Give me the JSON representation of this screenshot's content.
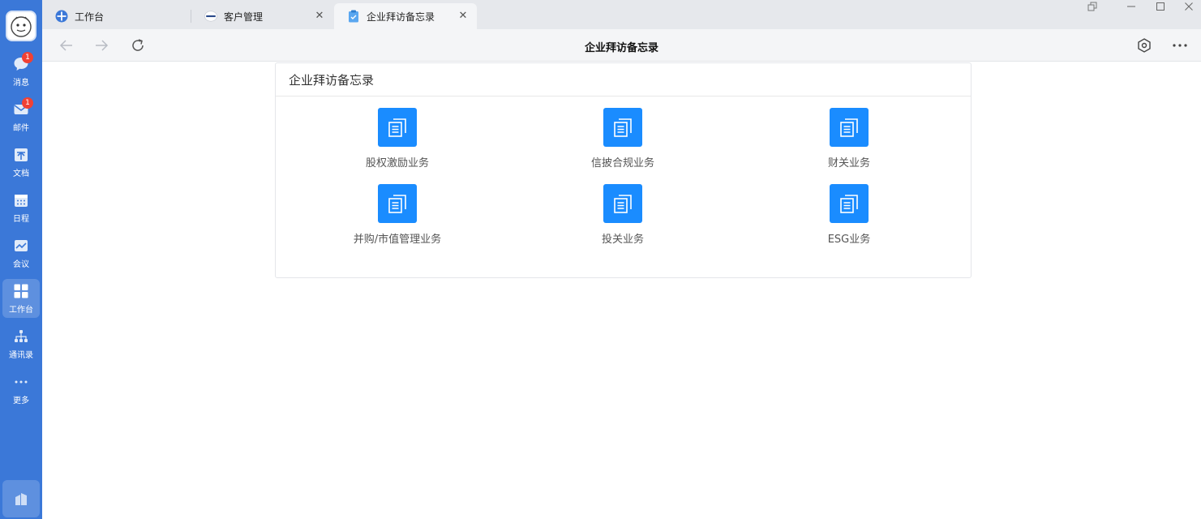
{
  "app": {
    "accent": "#3b78d8",
    "tile_color": "#1a8cff"
  },
  "rail": {
    "items": [
      {
        "label": "消息",
        "icon": "chat-bubble-icon",
        "badge": "1"
      },
      {
        "label": "邮件",
        "icon": "mail-icon",
        "badge": "1"
      },
      {
        "label": "文档",
        "icon": "document-icon"
      },
      {
        "label": "日程",
        "icon": "calendar-icon"
      },
      {
        "label": "会议",
        "icon": "meeting-icon"
      },
      {
        "label": "工作台",
        "icon": "grid-icon",
        "active": true
      },
      {
        "label": "通讯录",
        "icon": "org-chart-icon"
      },
      {
        "label": "更多",
        "icon": "more-dots-icon"
      }
    ]
  },
  "tabs": [
    {
      "label": "工作台",
      "icon": "workbench-icon"
    },
    {
      "label": "客户管理",
      "icon": "logo-icon"
    },
    {
      "label": "企业拜访备忘录",
      "icon": "clipboard-icon",
      "active": true
    }
  ],
  "toolbar": {
    "title": "企业拜访备忘录"
  },
  "card": {
    "title": "企业拜访备忘录",
    "tiles": [
      {
        "label": "股权激励业务"
      },
      {
        "label": "信披合规业务"
      },
      {
        "label": "财关业务"
      },
      {
        "label": "并购/市值管理业务"
      },
      {
        "label": "投关业务"
      },
      {
        "label": "ESG业务"
      }
    ]
  }
}
